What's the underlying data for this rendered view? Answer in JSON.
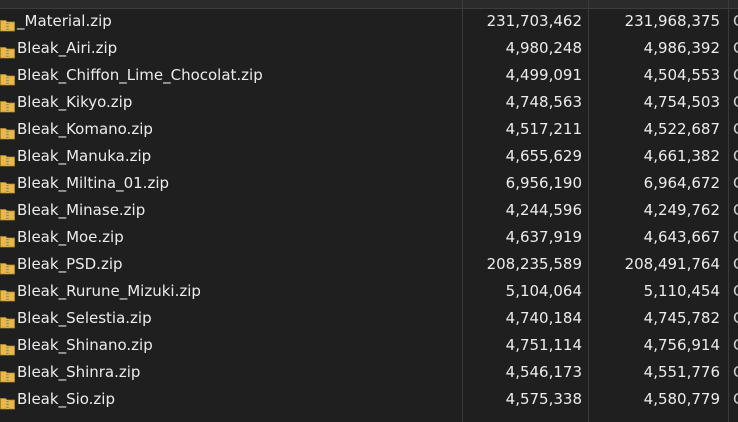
{
  "files": [
    {
      "name": "_Material.zip",
      "size": "231,703,462",
      "packed": "231,968,375",
      "extra": "C"
    },
    {
      "name": "Bleak_Airi.zip",
      "size": "4,980,248",
      "packed": "4,986,392",
      "extra": "C"
    },
    {
      "name": "Bleak_Chiffon_Lime_Chocolat.zip",
      "size": "4,499,091",
      "packed": "4,504,553",
      "extra": "C"
    },
    {
      "name": "Bleak_Kikyo.zip",
      "size": "4,748,563",
      "packed": "4,754,503",
      "extra": "C"
    },
    {
      "name": "Bleak_Komano.zip",
      "size": "4,517,211",
      "packed": "4,522,687",
      "extra": "C"
    },
    {
      "name": "Bleak_Manuka.zip",
      "size": "4,655,629",
      "packed": "4,661,382",
      "extra": "C"
    },
    {
      "name": "Bleak_Miltina_01.zip",
      "size": "6,956,190",
      "packed": "6,964,672",
      "extra": "C"
    },
    {
      "name": "Bleak_Minase.zip",
      "size": "4,244,596",
      "packed": "4,249,762",
      "extra": "C"
    },
    {
      "name": "Bleak_Moe.zip",
      "size": "4,637,919",
      "packed": "4,643,667",
      "extra": "C"
    },
    {
      "name": "Bleak_PSD.zip",
      "size": "208,235,589",
      "packed": "208,491,764",
      "extra": "C"
    },
    {
      "name": "Bleak_Rurune_Mizuki.zip",
      "size": "5,104,064",
      "packed": "5,110,454",
      "extra": "C"
    },
    {
      "name": "Bleak_Selestia.zip",
      "size": "4,740,184",
      "packed": "4,745,782",
      "extra": "C"
    },
    {
      "name": "Bleak_Shinano.zip",
      "size": "4,751,114",
      "packed": "4,756,914",
      "extra": "C"
    },
    {
      "name": "Bleak_Shinra.zip",
      "size": "4,546,173",
      "packed": "4,551,776",
      "extra": "C"
    },
    {
      "name": "Bleak_Sio.zip",
      "size": "4,575,338",
      "packed": "4,580,779",
      "extra": "C"
    }
  ],
  "icon": "zip-folder-icon",
  "colors": {
    "background": "#1f1f1f",
    "text": "#ececec",
    "folder": "#e8b84a",
    "zipper": "#8a6a2a"
  }
}
